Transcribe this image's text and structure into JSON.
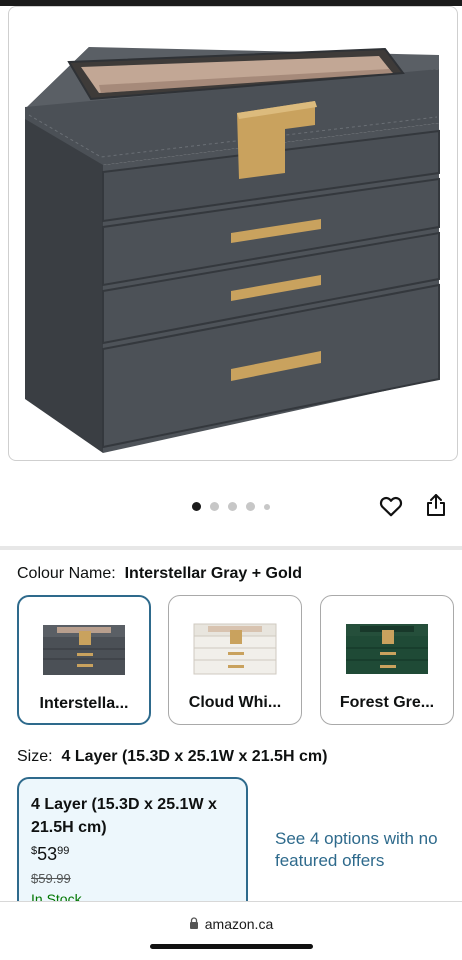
{
  "gallery": {
    "image_count": 5,
    "active_index": 0
  },
  "actions": {
    "wishlist_icon": "heart-icon",
    "share_icon": "share-icon"
  },
  "colour": {
    "label": "Colour Name:",
    "selected_value": "Interstellar Gray + Gold",
    "options": [
      {
        "name": "Interstella...",
        "body_color": "#4b5056",
        "selected": true
      },
      {
        "name": "Cloud Whi...",
        "body_color": "#f1efea",
        "selected": false
      },
      {
        "name": "Forest Gre...",
        "body_color": "#1f4a36",
        "selected": false
      }
    ]
  },
  "size": {
    "label": "Size:",
    "selected_value": "4 Layer (15.3D x 25.1W x 21.5H cm)",
    "card": {
      "title": "4 Layer (15.3D x 25.1W x 21.5H cm)",
      "price_symbol": "$",
      "price_whole": "53",
      "price_fraction": "99",
      "list_price": "$59.99",
      "availability": "In Stock"
    },
    "more_options": "See 4 options with no featured offers"
  },
  "browser": {
    "url": "amazon.ca"
  },
  "colors": {
    "accent": "#2e6a8c",
    "product_gray": "#4b5056",
    "gold": "#c9a25e"
  }
}
